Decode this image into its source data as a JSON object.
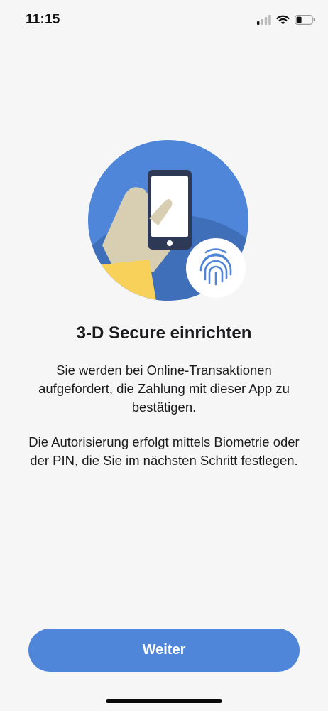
{
  "status_bar": {
    "time": "11:15",
    "icons": [
      "cellular-signal-icon",
      "wifi-icon",
      "battery-icon"
    ]
  },
  "illustration": {
    "name": "hand-holding-phone-with-fingerprint",
    "colors": {
      "circle": "#4f86d9",
      "circle_shade": "#3f6fb8",
      "hand": "#d8cfb3",
      "sleeve": "#f7d15a",
      "phone": "#2e3a55",
      "fingerprint": "#4f86d9"
    }
  },
  "content": {
    "title": "3-D Secure einrichten",
    "paragraph_1": "Sie werden bei Online-Transaktionen aufgefordert, die Zahlung mit dieser App zu bestätigen.",
    "paragraph_2": "Die Autorisierung erfolgt mittels Biometrie oder der PIN, die Sie im nächsten Schritt festlegen."
  },
  "actions": {
    "continue_label": "Weiter"
  },
  "colors": {
    "accent": "#4f86d9",
    "background": "#f6f6f6",
    "text": "#1c1c1e"
  }
}
